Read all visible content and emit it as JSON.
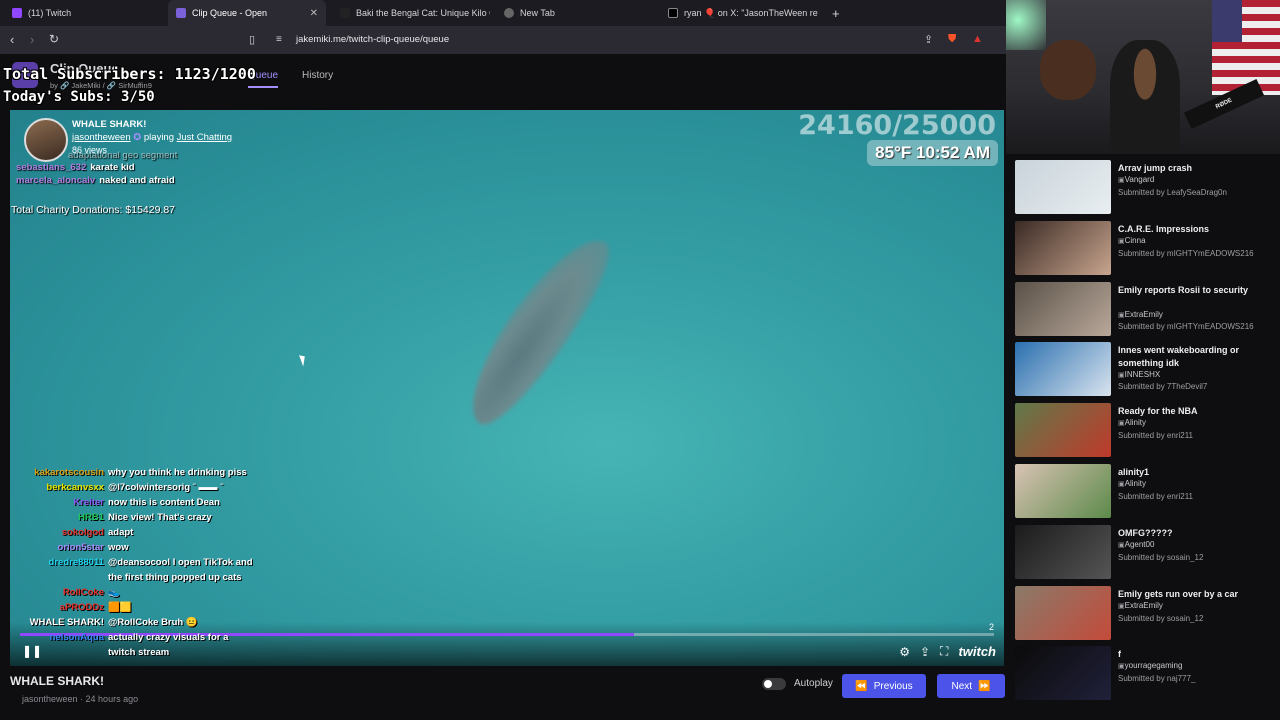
{
  "browser": {
    "tabs": [
      {
        "title": "(11) Twitch",
        "favicon_color": "#9147ff"
      },
      {
        "title": "Clip Queue - Open",
        "favicon_color": "#7b61d9",
        "close": "✕"
      },
      {
        "title": "Baki the Bengal Cat: Unique Kilo Cha",
        "favicon_color": "#222222"
      },
      {
        "title": "New Tab",
        "favicon_color": "#666666"
      },
      {
        "title": "ryan 🎈 on X: \"JasonTheWeen reveal",
        "favicon_color": "#000000"
      }
    ],
    "new_tab": "+",
    "url": "jakemiki.me/twitch-clip-queue/queue"
  },
  "app": {
    "title": "Clip Queue",
    "credits": "by 🔗 JakeMiki / 🔗 SirMuffin9",
    "nav": {
      "queue": "Queue",
      "history": "History"
    }
  },
  "overlay": {
    "subs": "Total Subscribers: 1123/1200",
    "today": "Today's Subs: 3/50",
    "counter": "24160/25000",
    "weather": "85°F 10:52 AM",
    "charity": "Total Charity Donations: $15429.87"
  },
  "clip": {
    "title": "WHALE SHARK!",
    "author": "jasontheween",
    "playing_text": "playing",
    "game": "Just Chatting",
    "views": "86 views",
    "ghost_line": "adaptational geo segment"
  },
  "video_chat_top": [
    {
      "name": "sebastians_632",
      "msg": "karate kid"
    },
    {
      "name": "marcela_aloncalv",
      "msg": "naked and afraid"
    }
  ],
  "chat": [
    {
      "name": "kakarotscousin",
      "color": "#d4a017",
      "msg": "why you think he drinking piss"
    },
    {
      "name": "berkcanvsxx",
      "color": "#e6e600",
      "msg": "@l7colwintersorig ˉ ▬▬ ˉ"
    },
    {
      "name": "Kreiter",
      "color": "#8a5cf6",
      "msg": "now this is content Dean"
    },
    {
      "name": "HRB1",
      "color": "#22c55e",
      "msg": "Nice view! That's crazy"
    },
    {
      "name": "sokolgod",
      "color": "#e0342f",
      "msg": "adapt"
    },
    {
      "name": "orion5star",
      "color": "#a78bfa",
      "msg": "wow"
    },
    {
      "name": "dredre88011",
      "color": "#22d3ee",
      "msg": "@deansocool I open TikTok and"
    },
    {
      "name": "",
      "color": "#ffffff",
      "msg": "the first thing popped up cats"
    },
    {
      "name": "RollCoke",
      "color": "#e0342f",
      "msg": "👟"
    },
    {
      "name": "aPRODDz",
      "color": "#e0342f",
      "msg": "🟧🟨"
    },
    {
      "name": "WHALE SHARK!",
      "color": "#ffffff",
      "msg": "@RollCoke Bruh 😐"
    },
    {
      "name": "nelsonAqua",
      "color": "#3b82f6",
      "msg": "actually crazy visuals for a"
    },
    {
      "name": "",
      "color": "#ffffff",
      "msg": "twitch stream"
    }
  ],
  "player": {
    "progress": 0.63,
    "viewer_count": "2",
    "pause_icon": "❚❚",
    "twitch_logo": "twitch"
  },
  "lower": {
    "title": "WHALE SHARK!",
    "meta": "jasontheween · 24 hours ago",
    "autoplay": "Autoplay",
    "prev": "Previous",
    "next": "Next"
  },
  "webcam": {
    "mic_label": "RØDE"
  },
  "queue": [
    {
      "title": "Arrav jump crash",
      "category": "Vangard",
      "submitted": "Submitted by LeafySeaDrag0n",
      "thumb": [
        "#c9d3da",
        "#e8eef1"
      ]
    },
    {
      "title": "C.A.R.E. Impressions",
      "category": "Cinna",
      "submitted": "Submitted by mIGHTYmEADOWS216",
      "thumb": [
        "#3a2a24",
        "#c8a58e"
      ]
    },
    {
      "title": "Emily reports Rosii to security",
      "category": "ExtraEmily",
      "submitted": "Submitted by mIGHTYmEADOWS216",
      "thumb": [
        "#5a5148",
        "#b9a89a"
      ]
    },
    {
      "title": "Innes went wakeboarding or something idk",
      "category": "INNESHX",
      "submitted": "Submitted by 7TheDevil7",
      "thumb": [
        "#2a6fb0",
        "#d9e4ee"
      ]
    },
    {
      "title": "Ready for the NBA",
      "category": "Alinity",
      "submitted": "Submitted by enri211",
      "thumb": [
        "#5f7a4a",
        "#c0392b"
      ]
    },
    {
      "title": "alinity1",
      "category": "Alinity",
      "submitted": "Submitted by enri211",
      "thumb": [
        "#d9c3b4",
        "#5c8a4a"
      ]
    },
    {
      "title": "OMFG?????",
      "category": "Agent00",
      "submitted": "Submitted by sosain_12",
      "thumb": [
        "#1b1b1b",
        "#555555"
      ]
    },
    {
      "title": "Emily gets run over by a car",
      "category": "ExtraEmily",
      "submitted": "Submitted by sosain_12",
      "thumb": [
        "#8a7a6a",
        "#c44b3a"
      ]
    },
    {
      "title": "f",
      "category": "yourragegaming",
      "submitted": "Submitted by naj777_",
      "thumb": [
        "#0b0b0b",
        "#20203a"
      ]
    }
  ]
}
